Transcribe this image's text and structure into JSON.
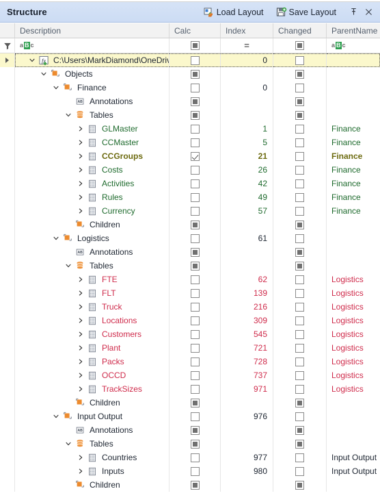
{
  "window": {
    "title": "Structure",
    "actions": [
      {
        "label": "Load Layout",
        "icon": "load-layout-icon"
      },
      {
        "label": "Save Layout",
        "icon": "save-layout-icon"
      }
    ],
    "pin_icon": "pin-icon",
    "close_icon": "close-icon"
  },
  "colors": {
    "titlebar": "#d0dff5",
    "selection": "#fbf8cc",
    "green": "#1f6b2e",
    "olive": "#6d6b10",
    "red": "#cf2b4b",
    "dark": "#1c2430",
    "accent_orange": "#ec8b2f"
  },
  "grid": {
    "columns": [
      {
        "key": "description",
        "label": "Description"
      },
      {
        "key": "calc",
        "label": "Calc"
      },
      {
        "key": "index",
        "label": "Index"
      },
      {
        "key": "changed",
        "label": "Changed"
      },
      {
        "key": "parentname",
        "label": "ParentName"
      }
    ],
    "filter_row": {
      "filter_icon": "funnel-icon",
      "description": {
        "type": "abc",
        "value": "aBc"
      },
      "calc": {
        "type": "box-square"
      },
      "index": {
        "type": "equals",
        "value": "="
      },
      "changed": {
        "type": "box-square"
      },
      "parentname": {
        "type": "abc",
        "value": "aBc"
      }
    },
    "rows": [
      {
        "depth": 0,
        "expander": "down",
        "icon": "formula-add-icon",
        "label": "C:\\Users\\MarkDiamond\\OneDrive - ...",
        "color": "dark",
        "calc": "unchecked",
        "index": "0",
        "index_color": "dark",
        "changed": "unchecked",
        "parent": "",
        "selected": true,
        "indicator": true
      },
      {
        "depth": 1,
        "expander": "down",
        "icon": "object-node-icon",
        "label": "Objects",
        "color": "dark",
        "calc": "box-square",
        "index": "",
        "index_color": "dark",
        "changed": "box-square",
        "parent": ""
      },
      {
        "depth": 2,
        "expander": "down",
        "icon": "object-node-icon",
        "label": "Finance",
        "color": "dark",
        "calc": "unchecked",
        "index": "0",
        "index_color": "dark",
        "changed": "unchecked",
        "parent": ""
      },
      {
        "depth": 3,
        "expander": "none",
        "icon": "annotations-icon",
        "label": "Annotations",
        "color": "dark",
        "calc": "box-square",
        "index": "",
        "index_color": "dark",
        "changed": "box-square",
        "parent": ""
      },
      {
        "depth": 3,
        "expander": "down",
        "icon": "tables-db-icon",
        "label": "Tables",
        "color": "dark",
        "calc": "box-square",
        "index": "",
        "index_color": "dark",
        "changed": "box-square",
        "parent": ""
      },
      {
        "depth": 4,
        "expander": "right",
        "icon": "table-icon",
        "label": "GLMaster",
        "color": "green",
        "calc": "unchecked",
        "index": "1",
        "index_color": "green",
        "changed": "unchecked",
        "parent": "Finance",
        "parent_color": "green"
      },
      {
        "depth": 4,
        "expander": "right",
        "icon": "table-icon",
        "label": "CCMaster",
        "color": "green",
        "calc": "unchecked",
        "index": "5",
        "index_color": "green",
        "changed": "unchecked",
        "parent": "Finance",
        "parent_color": "green"
      },
      {
        "depth": 4,
        "expander": "right",
        "icon": "table-icon",
        "label": "CCGroups",
        "color": "olive",
        "calc": "checked",
        "index": "21",
        "index_color": "olive",
        "changed": "unchecked",
        "parent": "Finance",
        "parent_color": "olive"
      },
      {
        "depth": 4,
        "expander": "right",
        "icon": "table-icon",
        "label": "Costs",
        "color": "green",
        "calc": "unchecked",
        "index": "26",
        "index_color": "green",
        "changed": "unchecked",
        "parent": "Finance",
        "parent_color": "green"
      },
      {
        "depth": 4,
        "expander": "right",
        "icon": "table-icon",
        "label": "Activities",
        "color": "green",
        "calc": "unchecked",
        "index": "42",
        "index_color": "green",
        "changed": "unchecked",
        "parent": "Finance",
        "parent_color": "green"
      },
      {
        "depth": 4,
        "expander": "right",
        "icon": "table-icon",
        "label": "Rules",
        "color": "green",
        "calc": "unchecked",
        "index": "49",
        "index_color": "green",
        "changed": "unchecked",
        "parent": "Finance",
        "parent_color": "green"
      },
      {
        "depth": 4,
        "expander": "right",
        "icon": "table-icon",
        "label": "Currency",
        "color": "green",
        "calc": "unchecked",
        "index": "57",
        "index_color": "green",
        "changed": "unchecked",
        "parent": "Finance",
        "parent_color": "green"
      },
      {
        "depth": 3,
        "expander": "none",
        "icon": "object-node-icon",
        "label": "Children",
        "color": "dark",
        "calc": "box-square",
        "index": "",
        "index_color": "dark",
        "changed": "box-square",
        "parent": ""
      },
      {
        "depth": 2,
        "expander": "down",
        "icon": "object-node-icon",
        "label": "Logistics",
        "color": "dark",
        "calc": "unchecked",
        "index": "61",
        "index_color": "dark",
        "changed": "unchecked",
        "parent": ""
      },
      {
        "depth": 3,
        "expander": "none",
        "icon": "annotations-icon",
        "label": "Annotations",
        "color": "dark",
        "calc": "box-square",
        "index": "",
        "index_color": "dark",
        "changed": "box-square",
        "parent": ""
      },
      {
        "depth": 3,
        "expander": "down",
        "icon": "tables-db-icon",
        "label": "Tables",
        "color": "dark",
        "calc": "box-square",
        "index": "",
        "index_color": "dark",
        "changed": "box-square",
        "parent": ""
      },
      {
        "depth": 4,
        "expander": "right",
        "icon": "table-icon",
        "label": "FTE",
        "color": "red",
        "calc": "unchecked",
        "index": "62",
        "index_color": "red",
        "changed": "unchecked",
        "parent": "Logistics",
        "parent_color": "red"
      },
      {
        "depth": 4,
        "expander": "right",
        "icon": "table-icon",
        "label": "FLT",
        "color": "red",
        "calc": "unchecked",
        "index": "139",
        "index_color": "red",
        "changed": "unchecked",
        "parent": "Logistics",
        "parent_color": "red"
      },
      {
        "depth": 4,
        "expander": "right",
        "icon": "table-icon",
        "label": "Truck",
        "color": "red",
        "calc": "unchecked",
        "index": "216",
        "index_color": "red",
        "changed": "unchecked",
        "parent": "Logistics",
        "parent_color": "red"
      },
      {
        "depth": 4,
        "expander": "right",
        "icon": "table-icon",
        "label": "Locations",
        "color": "red",
        "calc": "unchecked",
        "index": "309",
        "index_color": "red",
        "changed": "unchecked",
        "parent": "Logistics",
        "parent_color": "red"
      },
      {
        "depth": 4,
        "expander": "right",
        "icon": "table-icon",
        "label": "Customers",
        "color": "red",
        "calc": "unchecked",
        "index": "545",
        "index_color": "red",
        "changed": "unchecked",
        "parent": "Logistics",
        "parent_color": "red"
      },
      {
        "depth": 4,
        "expander": "right",
        "icon": "table-icon",
        "label": "Plant",
        "color": "red",
        "calc": "unchecked",
        "index": "721",
        "index_color": "red",
        "changed": "unchecked",
        "parent": "Logistics",
        "parent_color": "red"
      },
      {
        "depth": 4,
        "expander": "right",
        "icon": "table-icon",
        "label": "Packs",
        "color": "red",
        "calc": "unchecked",
        "index": "728",
        "index_color": "red",
        "changed": "unchecked",
        "parent": "Logistics",
        "parent_color": "red"
      },
      {
        "depth": 4,
        "expander": "right",
        "icon": "table-icon",
        "label": "OCCD",
        "color": "red",
        "calc": "unchecked",
        "index": "737",
        "index_color": "red",
        "changed": "unchecked",
        "parent": "Logistics",
        "parent_color": "red"
      },
      {
        "depth": 4,
        "expander": "right",
        "icon": "table-icon",
        "label": "TrackSizes",
        "color": "red",
        "calc": "unchecked",
        "index": "971",
        "index_color": "red",
        "changed": "unchecked",
        "parent": "Logistics",
        "parent_color": "red"
      },
      {
        "depth": 3,
        "expander": "none",
        "icon": "object-node-icon",
        "label": "Children",
        "color": "dark",
        "calc": "box-square",
        "index": "",
        "index_color": "dark",
        "changed": "box-square",
        "parent": ""
      },
      {
        "depth": 2,
        "expander": "down",
        "icon": "object-node-icon",
        "label": "Input Output",
        "color": "dark",
        "calc": "unchecked",
        "index": "976",
        "index_color": "dark",
        "changed": "unchecked",
        "parent": ""
      },
      {
        "depth": 3,
        "expander": "none",
        "icon": "annotations-icon",
        "label": "Annotations",
        "color": "dark",
        "calc": "box-square",
        "index": "",
        "index_color": "dark",
        "changed": "box-square",
        "parent": ""
      },
      {
        "depth": 3,
        "expander": "down",
        "icon": "tables-db-icon",
        "label": "Tables",
        "color": "dark",
        "calc": "box-square",
        "index": "",
        "index_color": "dark",
        "changed": "box-square",
        "parent": ""
      },
      {
        "depth": 4,
        "expander": "right",
        "icon": "table-icon",
        "label": "Countries",
        "color": "dark",
        "calc": "unchecked",
        "index": "977",
        "index_color": "dark",
        "changed": "unchecked",
        "parent": "Input Output",
        "parent_color": "dark"
      },
      {
        "depth": 4,
        "expander": "right",
        "icon": "table-icon",
        "label": "Inputs",
        "color": "dark",
        "calc": "unchecked",
        "index": "980",
        "index_color": "dark",
        "changed": "unchecked",
        "parent": "Input Output",
        "parent_color": "dark"
      },
      {
        "depth": 3,
        "expander": "none",
        "icon": "object-node-icon",
        "label": "Children",
        "color": "dark",
        "calc": "box-square",
        "index": "",
        "index_color": "dark",
        "changed": "box-square",
        "parent": ""
      }
    ]
  }
}
